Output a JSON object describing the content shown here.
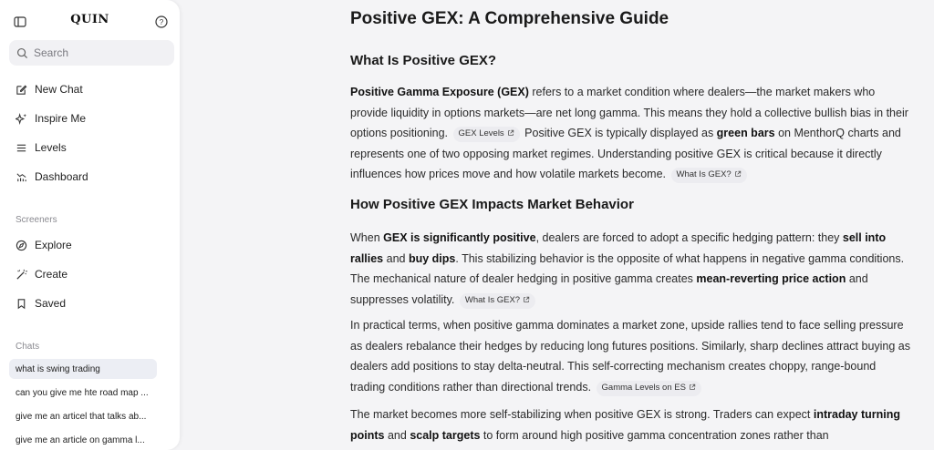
{
  "sidebar": {
    "logo": "QUIN",
    "search_placeholder": "Search",
    "nav": [
      {
        "label": "New Chat",
        "icon": "edit-icon"
      },
      {
        "label": "Inspire Me",
        "icon": "sparkles-icon"
      },
      {
        "label": "Levels",
        "icon": "menu-icon"
      },
      {
        "label": "Dashboard",
        "icon": "chart-icon"
      }
    ],
    "screeners_label": "Screeners",
    "screeners": [
      {
        "label": "Explore",
        "icon": "compass-icon"
      },
      {
        "label": "Create",
        "icon": "magic-wand-icon"
      },
      {
        "label": "Saved",
        "icon": "bookmark-icon"
      }
    ],
    "chats_label": "Chats",
    "chats": [
      "what is swing trading",
      "can you give me hte road map ...",
      "give me an articel that talks ab...",
      "give me an article on gamma l..."
    ]
  },
  "article": {
    "title": "Positive GEX: A Comprehensive Guide",
    "h2_1": "What Is Positive GEX?",
    "h2_2": "How Positive GEX Impacts Market Behavior",
    "p1": {
      "b1": "Positive Gamma Exposure (GEX)",
      "t1": " refers to a market condition where dealers—the market makers who provide liquidity in options markets—are net long gamma. This means they hold a collective bullish bias in their options positioning.",
      "chip1": "GEX Levels",
      "t2": " Positive GEX is typically displayed as ",
      "b2": "green bars",
      "t3": " on MenthorQ charts and represents one of two opposing market regimes. Understanding positive GEX is critical because it directly influences how prices move and how volatile markets become.",
      "chip2": "What Is GEX?"
    },
    "p2": {
      "t1": "When ",
      "b1": "GEX is significantly positive",
      "t2": ", dealers are forced to adopt a specific hedging pattern: they ",
      "b2": "sell into rallies",
      "t3": " and ",
      "b3": "buy dips",
      "t4": ". This stabilizing behavior is the opposite of what happens in negative gamma conditions. The mechanical nature of dealer hedging in positive gamma creates ",
      "b4": "mean-reverting price action",
      "t5": " and suppresses volatility.",
      "chip1": "What Is GEX?"
    },
    "p3": {
      "t1": "In practical terms, when positive gamma dominates a market zone, upside rallies tend to face selling pressure as dealers rebalance their hedges by reducing long futures positions. Similarly, sharp declines attract buying as dealers add positions to stay delta-neutral. This self-correcting mechanism creates choppy, range-bound trading conditions rather than directional trends.",
      "chip1": "Gamma Levels on ES"
    },
    "p4": {
      "t1": "The market becomes more self-stabilizing when positive GEX is strong. Traders can expect ",
      "b1": "intraday turning points",
      "t2": " and ",
      "b2": "scalp targets",
      "t3": " to form around high positive gamma concentration zones rather than"
    }
  }
}
